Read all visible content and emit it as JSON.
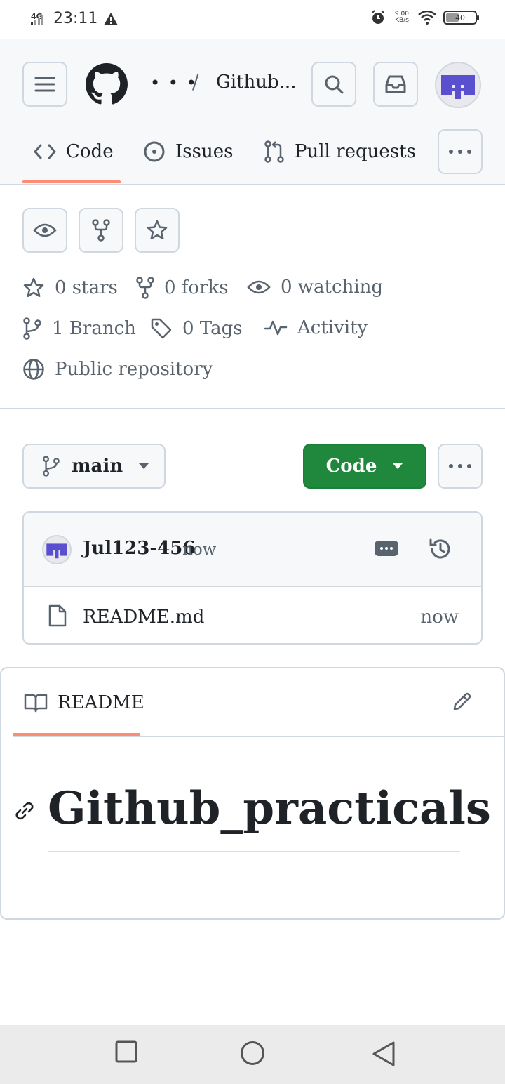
{
  "status_bar": {
    "network": "4G",
    "time": "23:11",
    "speed_value": "9.00",
    "speed_unit": "KB/s",
    "battery": "40"
  },
  "header": {
    "breadcrumb_more": "• • •",
    "breadcrumb_separator": "/",
    "repo_name": "Github..."
  },
  "tabs": [
    {
      "label": "Code",
      "icon": "code-icon",
      "selected": true
    },
    {
      "label": "Issues",
      "icon": "issue-opened-icon"
    },
    {
      "label": "Pull requests",
      "icon": "git-pull-request-icon"
    }
  ],
  "stats": {
    "stars": "0 stars",
    "forks": "0 forks",
    "watching": "0 watching",
    "branches": "1 Branch",
    "tags": "0 Tags",
    "activity": "Activity",
    "visibility": "Public repository"
  },
  "branch": {
    "name": "main"
  },
  "code_button": {
    "label": "Code",
    "color": "#1f883d"
  },
  "commit": {
    "user": "Jul123-456",
    "time": "now"
  },
  "files": [
    {
      "name": "README.md",
      "time": "now"
    }
  ],
  "readme": {
    "tab_label": "README",
    "heading": "Github_practicals"
  },
  "colors": {
    "accent_underline": "#fd8c73",
    "avatar_purple": "#5a4fcf",
    "border": "#d0d7de",
    "muted_text": "#59636e"
  }
}
